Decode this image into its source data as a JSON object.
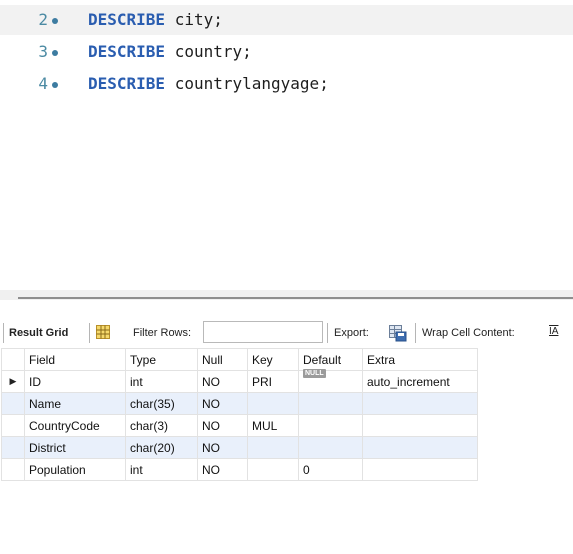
{
  "editor": {
    "lines": [
      {
        "number": "2",
        "keyword": "DESCRIBE",
        "argument": " city;",
        "active": true
      },
      {
        "number": "3",
        "keyword": "DESCRIBE",
        "argument": " country;",
        "active": false
      },
      {
        "number": "4",
        "keyword": "DESCRIBE",
        "argument": " countrylangyage;",
        "active": false
      }
    ]
  },
  "toolbar": {
    "result_grid_label": "Result Grid",
    "filter_rows_label": "Filter Rows:",
    "filter_value": "",
    "export_label": "Export:",
    "wrap_label": "Wrap Cell Content:",
    "wrap_icon": "̲I̲A"
  },
  "grid": {
    "columns": [
      "Field",
      "Type",
      "Null",
      "Key",
      "Default",
      "Extra"
    ],
    "rows": [
      {
        "Field": "ID",
        "Type": "int",
        "Null": "NO",
        "Key": "PRI",
        "Default": "NULL",
        "Extra": "auto_increment",
        "selected": true
      },
      {
        "Field": "Name",
        "Type": "char(35)",
        "Null": "NO",
        "Key": "",
        "Default": "",
        "Extra": ""
      },
      {
        "Field": "CountryCode",
        "Type": "char(3)",
        "Null": "NO",
        "Key": "MUL",
        "Default": "",
        "Extra": ""
      },
      {
        "Field": "District",
        "Type": "char(20)",
        "Null": "NO",
        "Key": "",
        "Default": "",
        "Extra": ""
      },
      {
        "Field": "Population",
        "Type": "int",
        "Null": "NO",
        "Key": "",
        "Default": "0",
        "Extra": ""
      }
    ],
    "null_badge": "NULL",
    "row_marker": "▶"
  },
  "colors": {
    "keyword": "#2a5db0",
    "line_number": "#4b8aa3",
    "alt_row": "#e9f0fb"
  }
}
